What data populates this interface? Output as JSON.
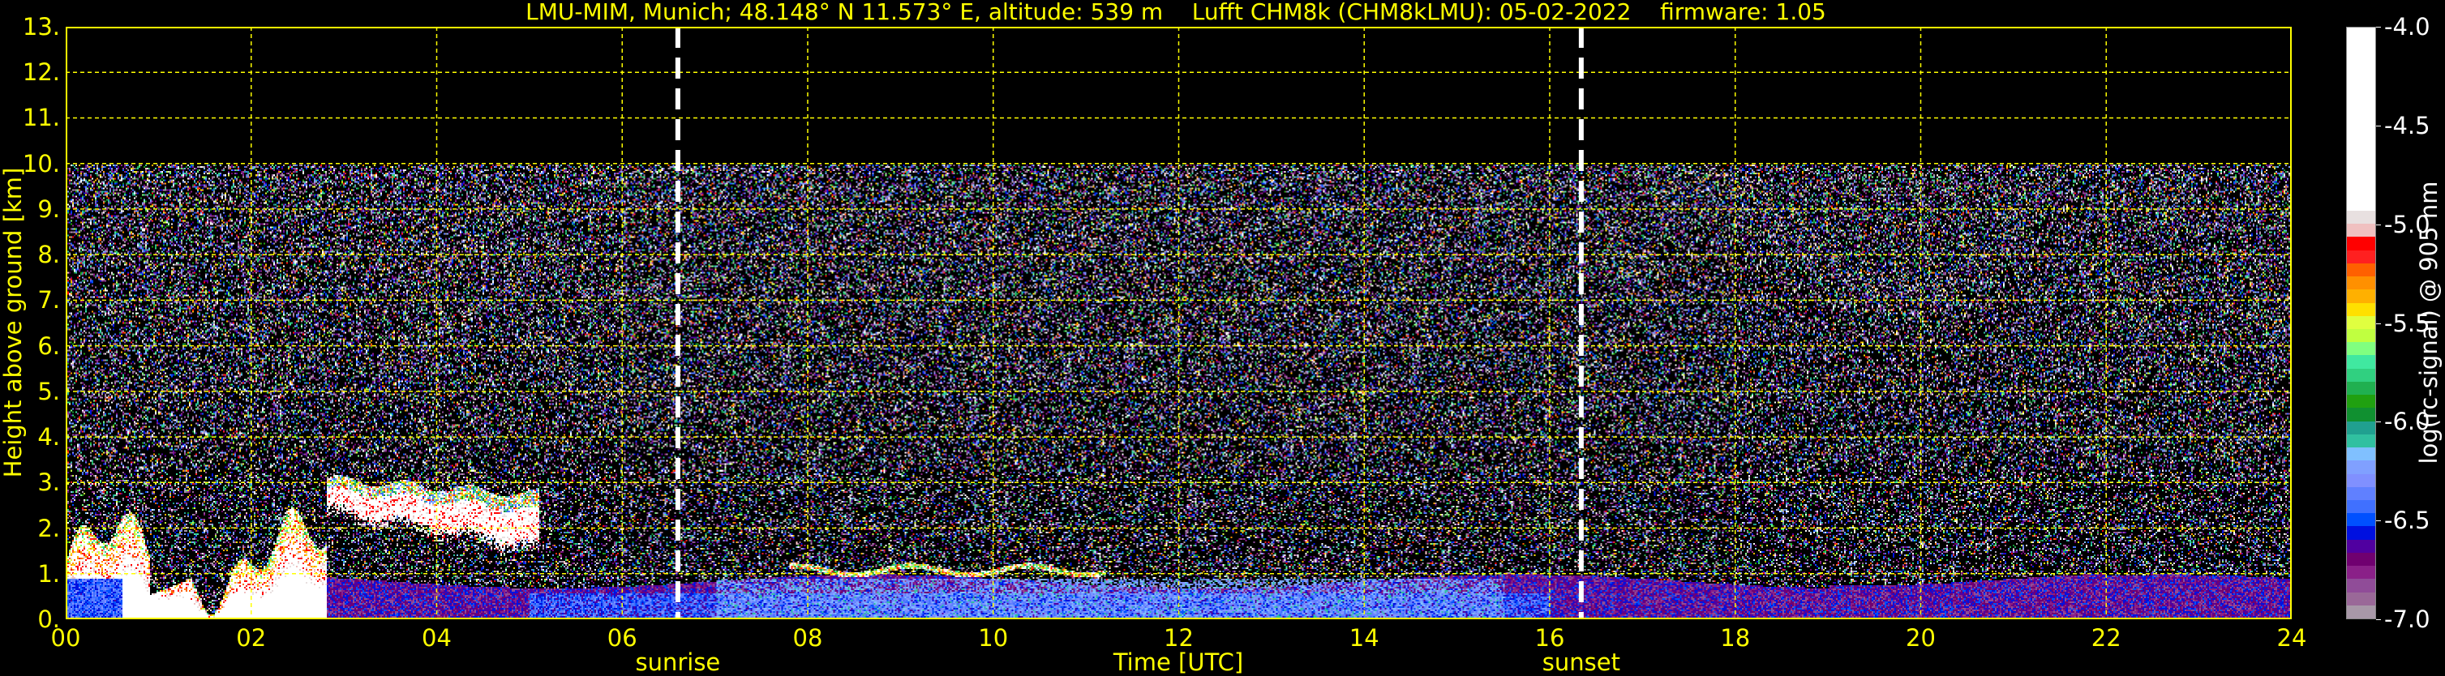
{
  "chart_data": {
    "type": "heatmap",
    "title": "LMU-MIM, Munich; 48.148° N 11.573° E, altitude: 539 m    Lufft CHM8k (CHM8kLMU): 05-02-2022    firmware: 1.05",
    "xlabel": "Time [UTC]",
    "ylabel": "Height above ground [km]",
    "xlim": [
      0,
      24
    ],
    "ylim": [
      0,
      13
    ],
    "grid": true,
    "x_ticks": [
      "00",
      "02",
      "04",
      "06",
      "08",
      "10",
      "12",
      "14",
      "16",
      "18",
      "20",
      "22",
      "24"
    ],
    "x_tick_values": [
      0,
      2,
      4,
      6,
      8,
      10,
      12,
      14,
      16,
      18,
      20,
      22,
      24
    ],
    "y_ticks": [
      "0.",
      "1.",
      "2.",
      "3.",
      "4.",
      "5.",
      "6.",
      "7.",
      "8.",
      "9.",
      "10.",
      "11.",
      "12.",
      "13."
    ],
    "y_tick_values": [
      0,
      1,
      2,
      3,
      4,
      5,
      6,
      7,
      8,
      9,
      10,
      11,
      12,
      13
    ],
    "data_top_km": 10,
    "vertical_markers": [
      {
        "label": "sunrise",
        "time_h": 6.6,
        "color": "#ffffff"
      },
      {
        "label": "sunset",
        "time_h": 16.34,
        "color": "#ffffff"
      }
    ],
    "colorbar": {
      "label": "log(rc-signal) @ 905 nm",
      "range": [
        -7.0,
        -4.0
      ],
      "ticks": [
        "-4.0",
        "-4.5",
        "-5.0",
        "-5.5",
        "-6.0",
        "-6.5",
        "-7.0"
      ],
      "tick_values": [
        -4.0,
        -4.5,
        -5.0,
        -5.5,
        -6.0,
        -6.5,
        -7.0
      ],
      "colors_low_to_high": [
        "#a898a8",
        "#9a6898",
        "#904c98",
        "#8a2088",
        "#700070",
        "#5000a0",
        "#0010e0",
        "#0050ff",
        "#4070ff",
        "#6080ff",
        "#8090ff",
        "#80a0ff",
        "#80c0ff",
        "#30c0a0",
        "#20a090",
        "#109030",
        "#20a010",
        "#20b050",
        "#30d080",
        "#40e8a0",
        "#80ff80",
        "#c0ff40",
        "#e0ff40",
        "#ffe000",
        "#ffb000",
        "#ff9000",
        "#ff6000",
        "#ff2020",
        "#ff0000",
        "#f0c0c0",
        "#e8e0e0"
      ],
      "saturation_color": "#ffffff",
      "saturation_from": -4.93
    },
    "features": [
      {
        "name": "boundary layer",
        "start_h": 2.8,
        "end_h": 24,
        "base_km": 0,
        "top_km": 1.0,
        "value": -6.7
      },
      {
        "name": "low cloud",
        "start_h": 0,
        "end_h": 2.8,
        "base_km": 0,
        "top_km": 2.2,
        "value": -4.5
      },
      {
        "name": "cloud layer",
        "start_h": 2.8,
        "end_h": 5.1,
        "base_km": 2.2,
        "top_km": 3.2,
        "value": -4.8
      },
      {
        "name": "cloud top",
        "start_h": 7.8,
        "end_h": 11.2,
        "base_km": 0.9,
        "top_km": 1.25,
        "value": -4.9
      }
    ]
  }
}
